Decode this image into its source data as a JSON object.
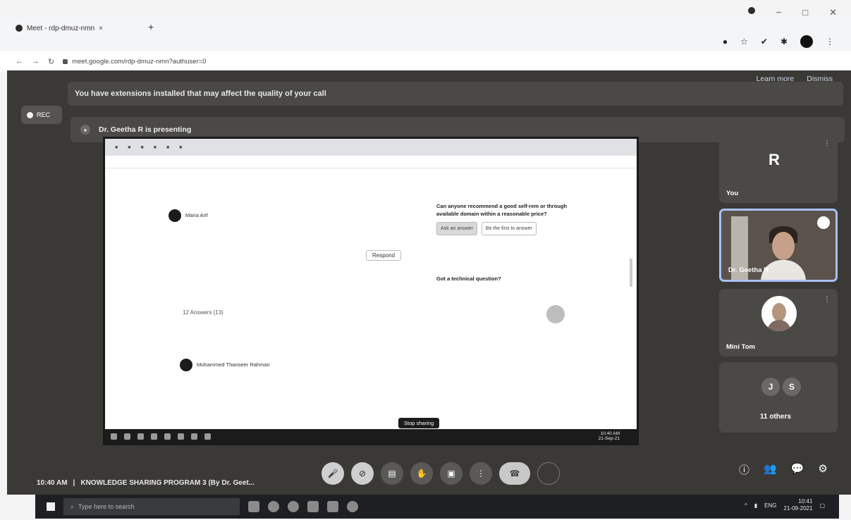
{
  "browser": {
    "tab_title": "Meet - rdp-dmuz-nmn",
    "tab_close": "×",
    "new_tab": "+",
    "url": "meet.google.com/rdp-dmuz-nmn?authuser=0",
    "window_controls": [
      "−",
      "□",
      "✕"
    ]
  },
  "banner": {
    "message": "You have extensions installed that may affect the quality of your call",
    "learn_more": "Learn more",
    "dismiss": "Dismiss"
  },
  "recording": {
    "label": "REC"
  },
  "presenting": {
    "label": "Dr. Geetha R is presenting"
  },
  "shared_screen": {
    "comment_author": "Maria Arif",
    "respond": "Respond",
    "answers": "12 Answers (13)",
    "comment2_author": "Mohammed Thanseer Rahman",
    "right_question": "Can anyone recommend a good self-rem or through available domain within a reasonable price?",
    "btn_ask": "Ask an answer",
    "btn_notify": "Be the first to answer",
    "tech_question": "Got a technical question?",
    "stop_sharing": "Stop sharing",
    "clock_time": "10:40 AM",
    "clock_date": "21-Sep-21"
  },
  "participants": [
    {
      "name": "You",
      "letter": "R"
    },
    {
      "name": "Dr. Geetha R"
    },
    {
      "name": "Mini Tom"
    },
    {
      "name": "11 others",
      "badges": [
        "J",
        "S"
      ]
    }
  ],
  "meeting": {
    "time": "10:40 AM",
    "separator": "|",
    "title": "KNOWLEDGE SHARING PROGRAM 3 (By Dr. Geet..."
  },
  "controls": [
    "mic",
    "camera",
    "captions",
    "raise-hand",
    "present",
    "more",
    "end-call",
    "blank"
  ],
  "side_controls": [
    "ⓘ",
    "👥",
    "💬",
    "⚙"
  ],
  "taskbar": {
    "search_placeholder": "Type here to search",
    "lang": "ENG",
    "time": "10:41",
    "date": "21-09-2021"
  }
}
